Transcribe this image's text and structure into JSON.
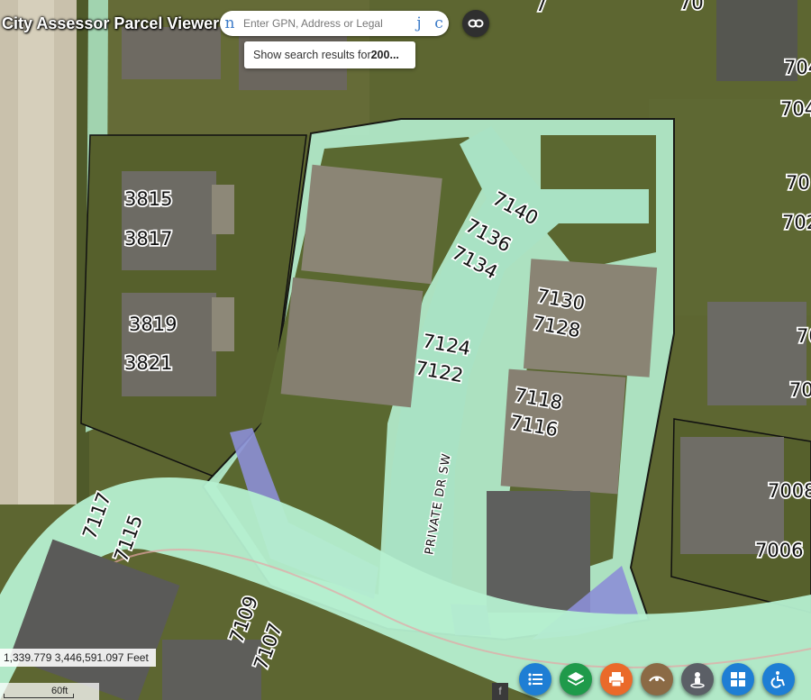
{
  "app": {
    "title": "City Assessor Parcel Viewer"
  },
  "search": {
    "placeholder": "Enter GPN, Address or Legal",
    "left_glyph": "n",
    "right_glyph_1": "j",
    "right_glyph_2": "c",
    "suggestion_prefix": "Show search results for ",
    "suggestion_bold": "200..."
  },
  "map": {
    "coordinates": "1,339.779 3,446,591.097 Feet",
    "scale_label": "60ft",
    "street_label": "PRIVATE DR SW",
    "address_labels": [
      "7140",
      "7136",
      "7134",
      "7130",
      "7128",
      "7124",
      "7122",
      "7118",
      "7116",
      "3815",
      "3817",
      "3819",
      "3821",
      "7117",
      "7115",
      "7109",
      "7107",
      "7008",
      "7006",
      "704",
      "704",
      "70",
      "702",
      "70",
      "70",
      "7",
      "70"
    ],
    "colors": {
      "parcel_fill": "#b5efd0",
      "easement_fill": "#8c8fd6",
      "parcel_line": "#111111",
      "button_blue": "#1e7ed4"
    }
  },
  "toolbar": {
    "stub_glyph": "f",
    "buttons": [
      {
        "icon": "list-icon",
        "color": "#1e7ed4"
      },
      {
        "icon": "layers-icon",
        "color": "#1f9a4a"
      },
      {
        "icon": "print-icon",
        "color": "#ea6a2a"
      },
      {
        "icon": "measure-icon",
        "color": "#8b6a45"
      },
      {
        "icon": "street-view-icon",
        "color": "#5b5f66"
      },
      {
        "icon": "grid-icon",
        "color": "#1e7ed4"
      },
      {
        "icon": "accessibility-icon",
        "color": "#1e7ed4"
      }
    ]
  }
}
